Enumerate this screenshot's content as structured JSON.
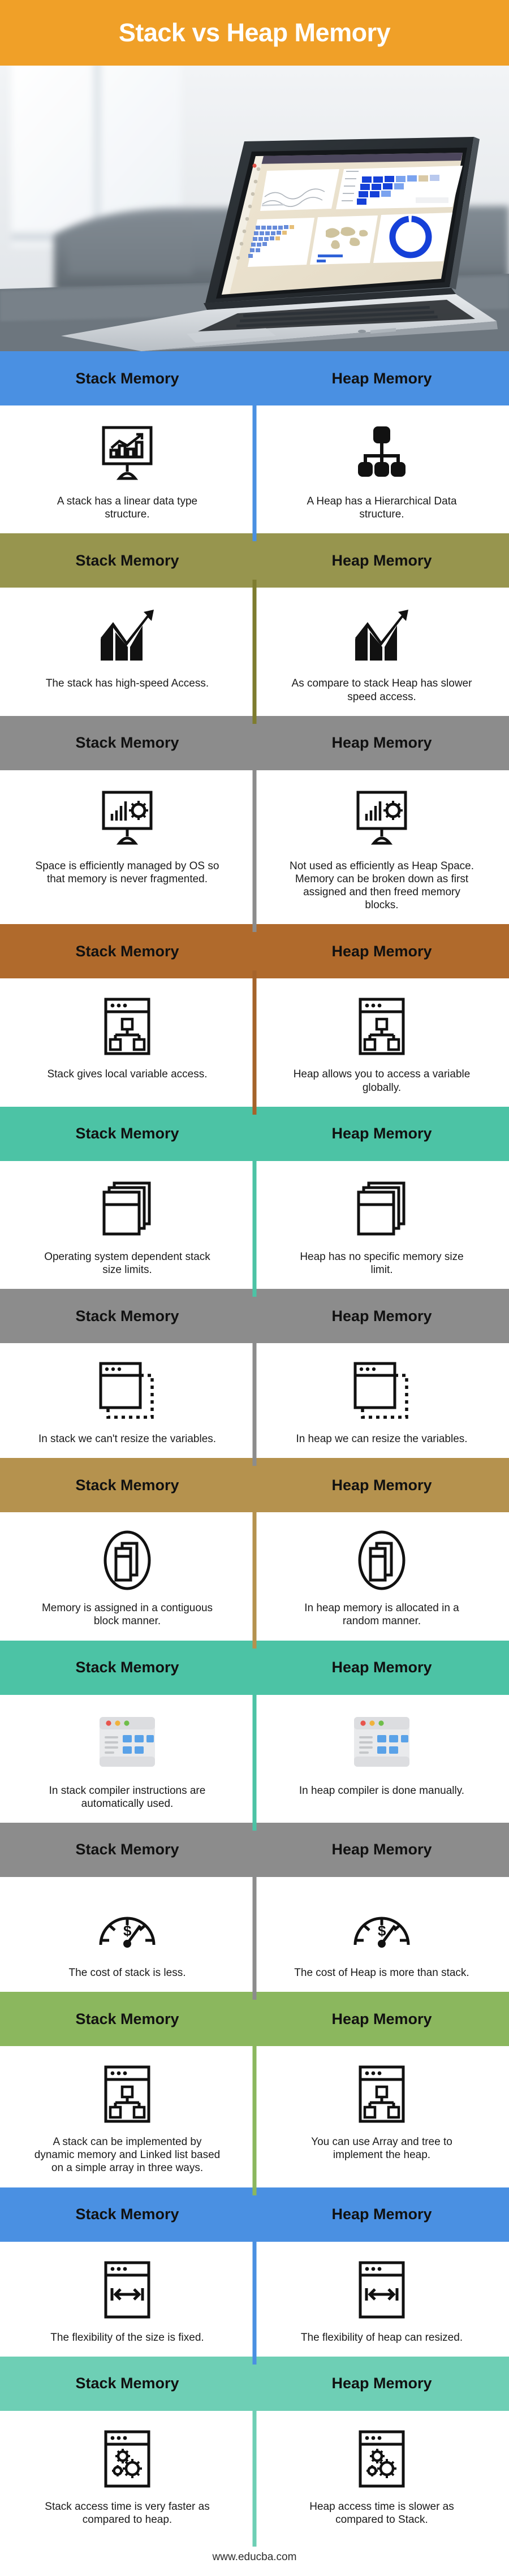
{
  "header": {
    "title": "Stack vs Heap Memory",
    "bg": "#F0A028",
    "text_color": "#FFFFFF"
  },
  "hero": {
    "alt": "laptop-on-couch-with-analytics-dashboard"
  },
  "column_headers": {
    "left": "Stack Memory",
    "right": "Heap Memory"
  },
  "footer": {
    "url": "www.educba.com"
  },
  "band_colors": {
    "blue": "#4A90E2",
    "olive": "#97954E",
    "gray": "#8C8C8C",
    "brown": "#B06A2C",
    "teal": "#4CC3A5",
    "tan": "#B5924E",
    "green": "#8BB75E"
  },
  "sections": [
    {
      "band_color": "#4A90E2",
      "divider_color": "#4A90E2",
      "left_header": "Stack Memory",
      "right_header": "Heap Memory",
      "left_icon": "monitor-bar-chart-icon",
      "right_icon": "hierarchy-tree-icon",
      "left_text": "A stack has a linear data type structure.",
      "right_text": "A Heap has a Hierarchical Data structure."
    },
    {
      "band_color": "#97954E",
      "divider_color": "#7E7C2E",
      "left_header": "Stack Memory",
      "right_header": "Heap Memory",
      "left_icon": "growth-arrow-bars-icon",
      "right_icon": "growth-arrow-bars-icon",
      "left_text": "The stack has high-speed Access.",
      "right_text": "As compare to stack Heap has slower speed access."
    },
    {
      "band_color": "#8C8C8C",
      "divider_color": "#8C8C8C",
      "left_header": "Stack Memory",
      "right_header": "Heap Memory",
      "left_icon": "monitor-settings-icon",
      "right_icon": "monitor-settings-icon",
      "left_text": "Space is efficiently managed by OS so that memory is never fragmented.",
      "right_text": "Not used as efficiently as Heap Space. Memory can be broken down as first assigned and then freed memory blocks."
    },
    {
      "band_color": "#B06A2C",
      "divider_color": "#A5632A",
      "left_header": "Stack Memory",
      "right_header": "Heap Memory",
      "left_icon": "window-sitemap-icon",
      "right_icon": "window-sitemap-icon",
      "left_text": "Stack gives local variable access.",
      "right_text": "Heap allows you to access a variable globally."
    },
    {
      "band_color": "#4CC3A5",
      "divider_color": "#4CC3A5",
      "left_header": "Stack Memory",
      "right_header": "Heap Memory",
      "left_icon": "stacked-pages-icon",
      "right_icon": "stacked-pages-icon",
      "left_text": "Operating system dependent stack size limits.",
      "right_text": "Heap has no specific memory size limit."
    },
    {
      "band_color": "#8C8C8C",
      "divider_color": "#8C8C8C",
      "left_header": "Stack Memory",
      "right_header": "Heap Memory",
      "left_icon": "window-resize-dashed-icon",
      "right_icon": "window-resize-dashed-icon",
      "left_text": "In stack we can't resize the variables.",
      "right_text": "In heap we can resize the variables."
    },
    {
      "band_color": "#B5924E",
      "divider_color": "#B5924E",
      "left_header": "Stack Memory",
      "right_header": "Heap Memory",
      "left_icon": "contiguous-blocks-circle-icon",
      "right_icon": "contiguous-blocks-circle-icon",
      "left_text": "Memory is assigned in a contiguous block manner.",
      "right_text": "In heap memory is allocated in a random manner."
    },
    {
      "band_color": "#4CC3A5",
      "divider_color": "#4CC3A5",
      "left_header": "Stack Memory",
      "right_header": "Heap Memory",
      "left_icon": "browser-dashboard-color-icon",
      "right_icon": "browser-dashboard-color-icon",
      "left_text": "In stack compiler instructions are automatically used.",
      "right_text": "In heap compiler is done manually."
    },
    {
      "band_color": "#8C8C8C",
      "divider_color": "#8C8C8C",
      "left_header": "Stack Memory",
      "right_header": "Heap Memory",
      "left_icon": "cost-gauge-dollar-icon",
      "right_icon": "cost-gauge-dollar-icon",
      "left_text": "The cost of stack is less.",
      "right_text": "The cost of Heap is more than stack."
    },
    {
      "band_color": "#8BB75E",
      "divider_color": "#8BB75E",
      "left_header": "Stack Memory",
      "right_header": "Heap Memory",
      "left_icon": "window-sitemap-icon",
      "right_icon": "window-sitemap-icon",
      "left_text": "A stack can be implemented by dynamic memory and Linked list based on a simple array in three ways.",
      "right_text": "You can use Array and tree to implement the heap."
    },
    {
      "band_color": "#4A90E2",
      "divider_color": "#4A90E2",
      "left_header": "Stack Memory",
      "right_header": "Heap Memory",
      "left_icon": "window-arrows-width-icon",
      "right_icon": "window-arrows-width-icon",
      "left_text": "The flexibility of the size is fixed.",
      "right_text": "The flexibility of heap can resized."
    },
    {
      "band_color": "#6ECFB5",
      "divider_color": "#6ECFB5",
      "left_header": "Stack Memory",
      "right_header": "Heap Memory",
      "left_icon": "window-gears-icon",
      "right_icon": "window-gears-icon",
      "left_text": "Stack access time is very faster as compared to heap.",
      "right_text": "Heap access time is slower as compared to Stack."
    }
  ]
}
